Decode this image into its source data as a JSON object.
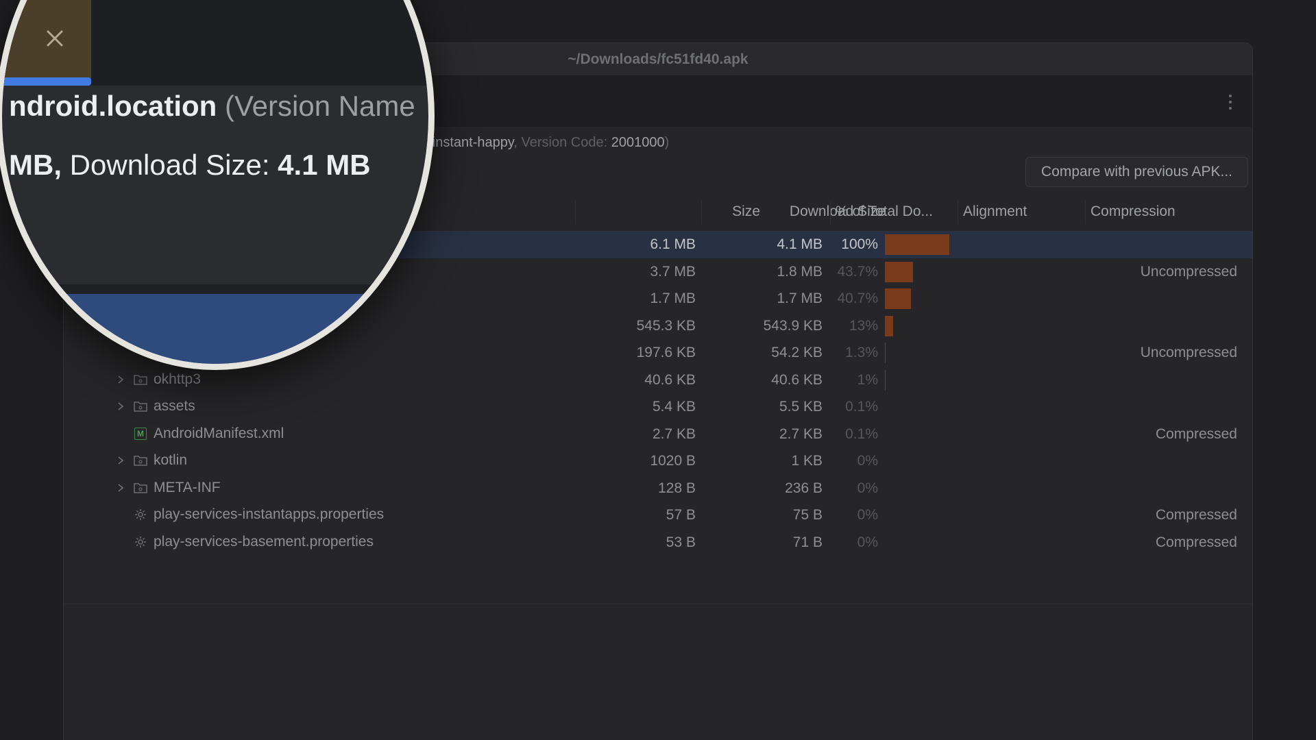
{
  "window": {
    "title": "~/Downloads/fc51fd40.apk"
  },
  "summary": {
    "app_id_visible": "0-instant-happy",
    "version_code_label": "Version Code:",
    "version_code": "2001000"
  },
  "magnifier": {
    "app_id": "ndroid.location",
    "version_name_label": "(Version Name",
    "size_text": "MB,",
    "download_label": "Download Size:",
    "download_value": "4.1 MB",
    "tab_accent": "#3f7be0"
  },
  "compare_button": "Compare with previous APK...",
  "columns": {
    "size": "Size",
    "download_size": "Download Size",
    "percent": "% of Total Do...",
    "alignment": "Alignment",
    "compression": "Compression"
  },
  "rows": [
    {
      "name": "",
      "icon": "",
      "expandable": false,
      "size": "6.1 MB",
      "download": "4.1 MB",
      "percent": "100%",
      "percent_value": 100,
      "compression": "",
      "selected": true
    },
    {
      "name": "",
      "icon": "",
      "expandable": false,
      "size": "3.7 MB",
      "download": "1.8 MB",
      "percent": "43.7%",
      "percent_value": 43.7,
      "compression": "Uncompressed"
    },
    {
      "name": "",
      "icon": "",
      "expandable": false,
      "size": "1.7 MB",
      "download": "1.7 MB",
      "percent": "40.7%",
      "percent_value": 40.7,
      "compression": ""
    },
    {
      "name": "",
      "icon": "",
      "expandable": false,
      "size": "545.3 KB",
      "download": "543.9 KB",
      "percent": "13%",
      "percent_value": 13,
      "compression": ""
    },
    {
      "name": "",
      "icon": "",
      "expandable": false,
      "size": "197.6 KB",
      "download": "54.2 KB",
      "percent": "1.3%",
      "percent_value": 1.3,
      "compression": "Uncompressed"
    },
    {
      "name": "okhttp3",
      "icon": "folder-icon",
      "expandable": true,
      "size": "40.6 KB",
      "download": "40.6 KB",
      "percent": "1%",
      "percent_value": 1,
      "compression": ""
    },
    {
      "name": "assets",
      "icon": "folder-icon",
      "expandable": true,
      "size": "5.4 KB",
      "download": "5.5 KB",
      "percent": "0.1%",
      "percent_value": 0.1,
      "compression": ""
    },
    {
      "name": "AndroidManifest.xml",
      "icon": "manifest-icon",
      "expandable": false,
      "size": "2.7 KB",
      "download": "2.7 KB",
      "percent": "0.1%",
      "percent_value": 0.1,
      "compression": "Compressed"
    },
    {
      "name": "kotlin",
      "icon": "folder-icon",
      "expandable": true,
      "size": "1020 B",
      "download": "1 KB",
      "percent": "0%",
      "percent_value": 0,
      "compression": ""
    },
    {
      "name": "META-INF",
      "icon": "folder-icon",
      "expandable": true,
      "size": "128 B",
      "download": "236 B",
      "percent": "0%",
      "percent_value": 0,
      "compression": ""
    },
    {
      "name": "play-services-instantapps.properties",
      "icon": "gear-icon",
      "expandable": false,
      "size": "57 B",
      "download": "75 B",
      "percent": "0%",
      "percent_value": 0,
      "compression": "Compressed"
    },
    {
      "name": "play-services-basement.properties",
      "icon": "gear-icon",
      "expandable": false,
      "size": "53 B",
      "download": "71 B",
      "percent": "0%",
      "percent_value": 0,
      "compression": "Compressed"
    }
  ],
  "colors": {
    "selection": "#283044",
    "bar": "#7a3a1c"
  }
}
